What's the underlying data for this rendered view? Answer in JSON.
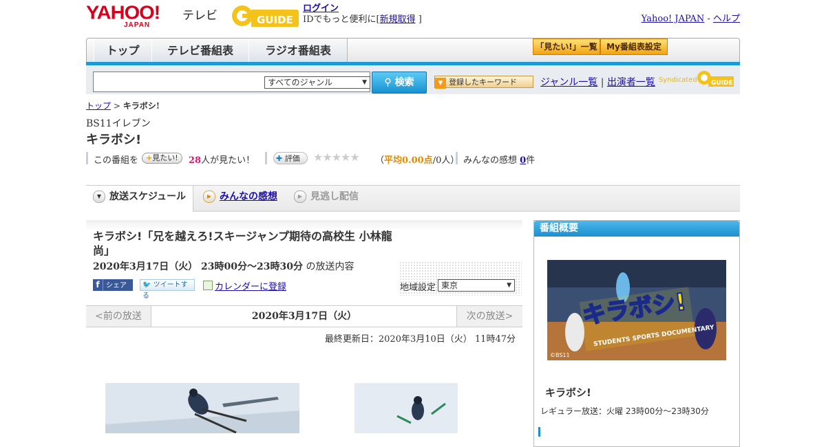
{
  "header": {
    "yahoo_logo": "YAHOO!",
    "yahoo_japan": "JAPAN",
    "tv_label": "テレビ",
    "gguide_logo": "GUIDE",
    "login": "ログイン",
    "id_text_pre": "IDでもっと便利に[",
    "new_account": "新規取得",
    "id_text_post": "]",
    "yahoo_japan_link": "Yahoo! JAPAN",
    "dash": "-",
    "help": "ヘルプ"
  },
  "nav": {
    "tabs": [
      "トップ",
      "テレビ番組表",
      "ラジオ番組表"
    ],
    "mitai_list": "「見たい!」一覧",
    "my_schedule": "My番組表設定"
  },
  "search": {
    "genre": "すべてのジャンル",
    "button": "検索",
    "keyword_button": "登録したキーワード",
    "genre_list": "ジャンル一覧",
    "divider": "|",
    "performer_list": "出演者一覧",
    "syndicated": "Syndicated",
    "syndicated_logo": "GUIDE"
  },
  "breadcrumb": {
    "top": "トップ",
    "sep": ">",
    "current": "キラボシ!"
  },
  "program": {
    "channel": "BS11イレブン",
    "title": "キラボシ!",
    "mitai_prefix": "この番組を",
    "mitai_button": "見たい!",
    "mitai_count": "28",
    "mitai_suffix": "人が見たい！",
    "rating_button": "評価",
    "stars": "★★★★★",
    "rating_open": "（",
    "rating_avg": "平均0.00点",
    "rating_people": "/0人）",
    "impressions_label": "みんなの感想",
    "impressions_count": "0",
    "impressions_unit": "件"
  },
  "tabs": [
    "放送スケジュール",
    "みんなの感想",
    "見逃し配信"
  ],
  "episode": {
    "title": "キラボシ!「兄を越えろ!スキージャンプ期待の高校生 小林龍尚」",
    "date_time": "2020年3月17日（火） 23時00分～23時30分",
    "suffix": "の放送内容",
    "share": "シェア",
    "tweet": "ツイートする",
    "calendar": "カレンダーに登録",
    "region_label": "地域設定",
    "region": "東京"
  },
  "pager": {
    "prev": "<前の放送",
    "current": "2020年3月17日（火）",
    "next": "次の放送>"
  },
  "updated": "最終更新日：2020年3月10日（火） 11時47分",
  "sidebar": {
    "header": "番組概要",
    "image_text": "キラボシ!",
    "image_sub": "STUDENTS SPORTS DOCUMENTARY",
    "image_credit": "©BS11",
    "name": "キラボシ!",
    "regular": "レギュラー放送：火曜 23時00分～23時30分"
  },
  "colors": {
    "accent_blue": "#1a9ad6",
    "yahoo_red": "#d6001c",
    "gguide_yellow": "#f5c21b",
    "pink_count": "#d81b6a"
  }
}
